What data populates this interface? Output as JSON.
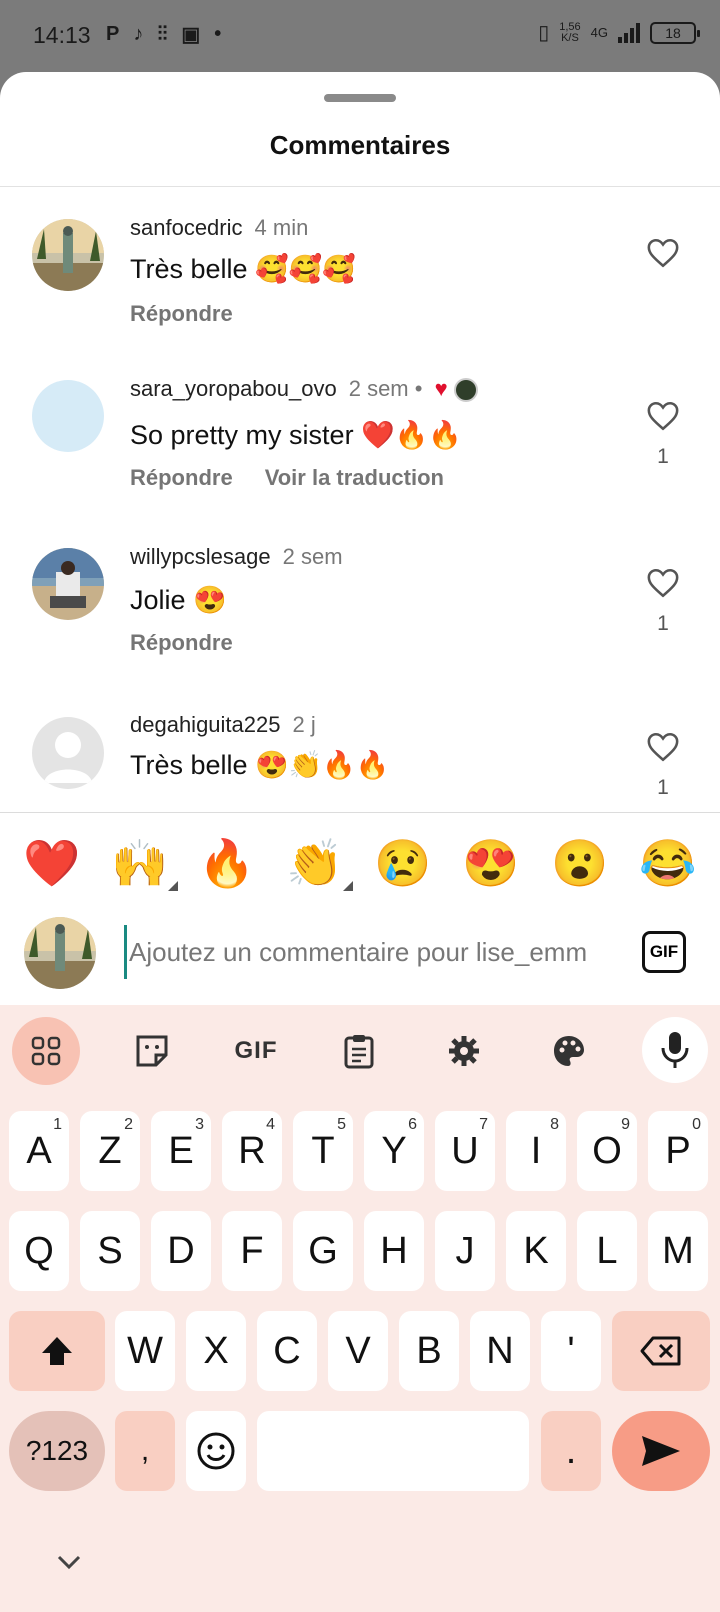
{
  "status_bar": {
    "time": "14:13",
    "left_icons": [
      "P",
      "♪",
      "⫶⫶",
      "▣",
      "•"
    ],
    "speed_value": "1,56",
    "speed_unit": "K/S",
    "network": "4G",
    "battery": "18"
  },
  "sheet": {
    "title": "Commentaires"
  },
  "comments": [
    {
      "username": "sanfocedric",
      "time": "4 min",
      "text": "Très belle 🥰🥰🥰",
      "actions": [
        "Répondre"
      ],
      "likes": "",
      "author_reacted": false
    },
    {
      "username": "sara_yoropabou_ovo",
      "time": "2 sem •",
      "text": "So pretty my sister ❤️🔥🔥",
      "actions": [
        "Répondre",
        "Voir la traduction"
      ],
      "likes": "1",
      "author_reacted": true
    },
    {
      "username": "willypcslesage",
      "time": "2 sem",
      "text": "Jolie 😍",
      "actions": [
        "Répondre"
      ],
      "likes": "1",
      "author_reacted": false
    },
    {
      "username": "degahiguita225",
      "time": "2 j",
      "text": "Très belle 😍👏🔥🔥",
      "actions": [],
      "likes": "1",
      "author_reacted": false
    }
  ],
  "reactions": [
    "❤️",
    "🙌",
    "🔥",
    "👏",
    "😢",
    "😍",
    "😮",
    "😂"
  ],
  "composer": {
    "placeholder": "Ajoutez un commentaire pour lise_emm",
    "gif_label": "GIF"
  },
  "keyboard": {
    "toolbar_gif": "GIF",
    "row1": [
      {
        "key": "A",
        "hint": "1"
      },
      {
        "key": "Z",
        "hint": "2"
      },
      {
        "key": "E",
        "hint": "3"
      },
      {
        "key": "R",
        "hint": "4"
      },
      {
        "key": "T",
        "hint": "5"
      },
      {
        "key": "Y",
        "hint": "6"
      },
      {
        "key": "U",
        "hint": "7"
      },
      {
        "key": "I",
        "hint": "8"
      },
      {
        "key": "O",
        "hint": "9"
      },
      {
        "key": "P",
        "hint": "0"
      }
    ],
    "row2": [
      "Q",
      "S",
      "D",
      "F",
      "G",
      "H",
      "J",
      "K",
      "L",
      "M"
    ],
    "row3": [
      "W",
      "X",
      "C",
      "V",
      "B",
      "N",
      "'"
    ],
    "symbols_key": "?123",
    "comma_key": ",",
    "period_key": "."
  },
  "colors": {
    "keyboard_bg": "#fbeae6",
    "accent_key": "#f9cfc2",
    "send_key": "#f79c86",
    "like_heart": "#e0102e"
  }
}
